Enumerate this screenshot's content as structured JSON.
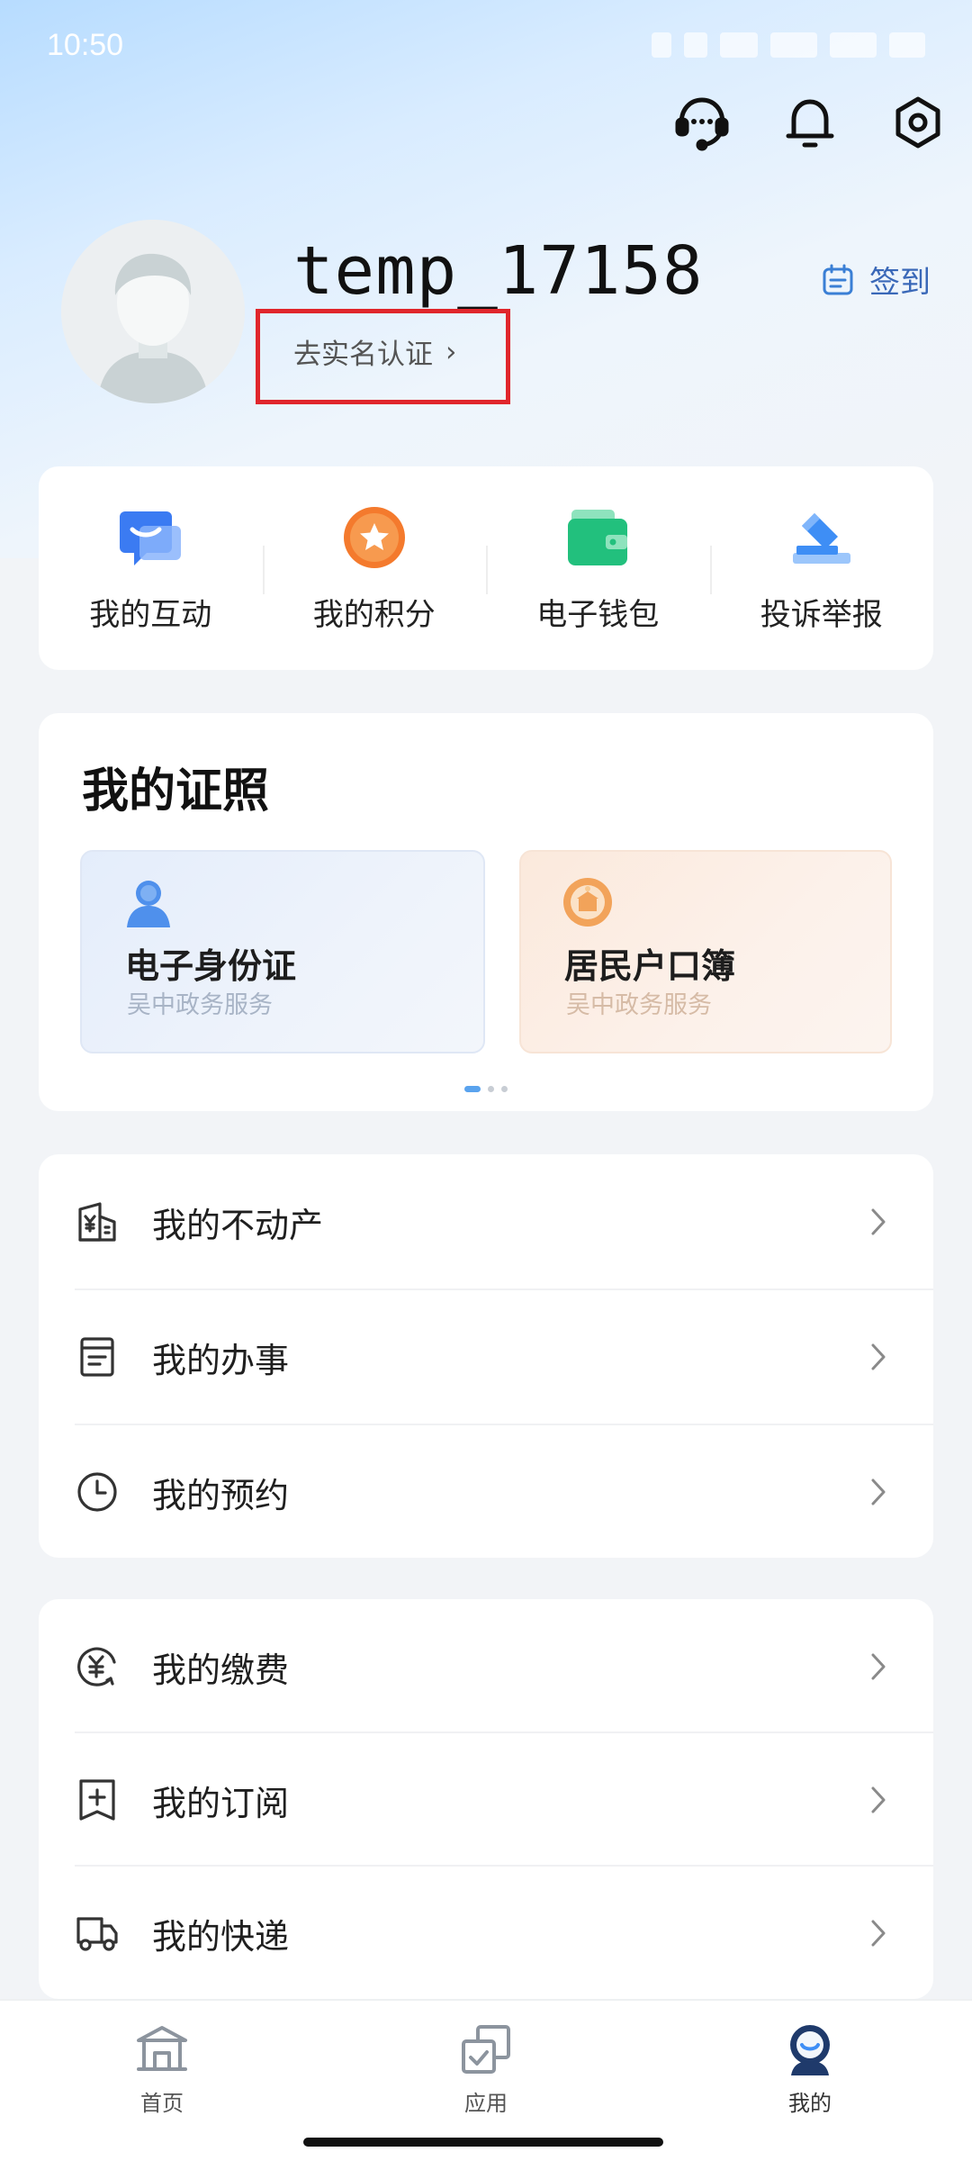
{
  "status": {
    "time": "10:50"
  },
  "header": {
    "icons": [
      "customer-service-icon",
      "bell-icon",
      "gear-icon"
    ]
  },
  "profile": {
    "username": "temp_17158",
    "verify_label": "去实名认证",
    "verify_chevron": "›",
    "signin_label": "签到"
  },
  "quick_actions": [
    {
      "label": "我的互动",
      "icon": "chat-bubble-icon",
      "color": "#3b7bf2"
    },
    {
      "label": "我的积分",
      "icon": "star-badge-icon",
      "color": "#f47a2d"
    },
    {
      "label": "电子钱包",
      "icon": "wallet-icon",
      "color": "#22c07d"
    },
    {
      "label": "投诉举报",
      "icon": "report-icon",
      "color": "#3e8ef5"
    }
  ],
  "licenses": {
    "title": "我的证照",
    "cards": [
      {
        "name": "电子身份证",
        "sub": "吴中政务服务",
        "icon": "person-icon"
      },
      {
        "name": "居民户口簿",
        "sub": "吴中政务服务",
        "icon": "emblem-icon"
      }
    ],
    "page_count": 3,
    "active_page": 0
  },
  "menu_group_1": [
    {
      "label": "我的不动产",
      "icon": "property-icon"
    },
    {
      "label": "我的办事",
      "icon": "document-icon"
    },
    {
      "label": "我的预约",
      "icon": "clock-icon"
    }
  ],
  "menu_group_2": [
    {
      "label": "我的缴费",
      "icon": "payment-icon"
    },
    {
      "label": "我的订阅",
      "icon": "subscribe-icon"
    },
    {
      "label": "我的快递",
      "icon": "delivery-icon"
    }
  ],
  "bottom_nav": [
    {
      "label": "首页",
      "icon": "home-icon",
      "active": false
    },
    {
      "label": "应用",
      "icon": "apps-icon",
      "active": false
    },
    {
      "label": "我的",
      "icon": "profile-icon",
      "active": true
    }
  ]
}
